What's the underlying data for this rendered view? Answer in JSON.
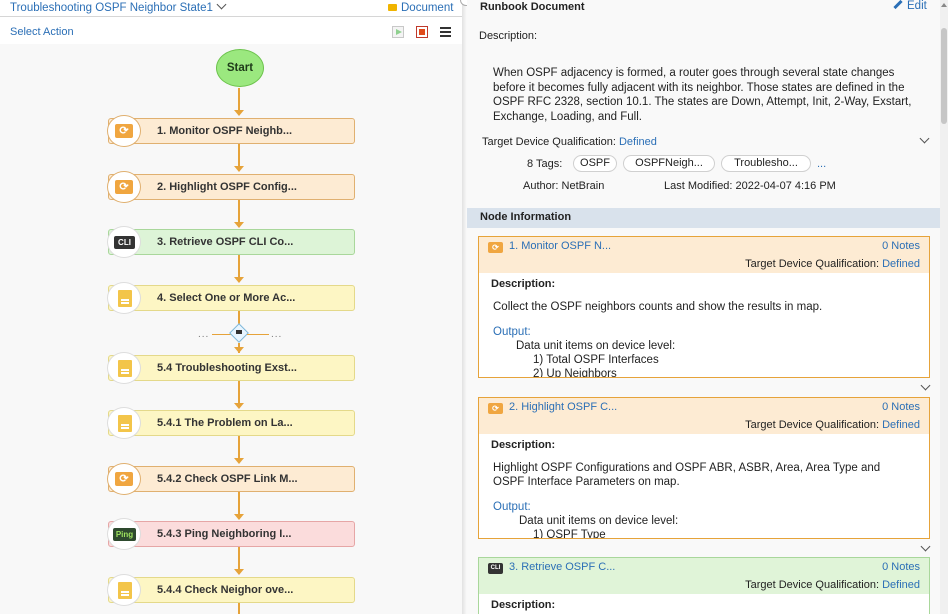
{
  "left": {
    "title": "Troubleshooting OSPF Neighbor State1",
    "document_link": "Document",
    "select_action": "Select Action",
    "start_label": "Start",
    "decision_left": "...",
    "decision_right": "...",
    "nodes": [
      {
        "label": "1. Monitor OSPF Neighb...",
        "color": "orange",
        "icon": "refresh-icon"
      },
      {
        "label": "2. Highlight OSPF Config...",
        "color": "orange",
        "icon": "refresh-icon"
      },
      {
        "label": "3. Retrieve OSPF CLI Co...",
        "color": "green",
        "icon": "cli-icon",
        "icon_text": "CLI"
      },
      {
        "label": "4. Select One or More Ac...",
        "color": "yellow",
        "icon": "document-icon"
      },
      {
        "label": "5.4 Troubleshooting Exst...",
        "color": "yellow",
        "icon": "document-icon"
      },
      {
        "label": "5.4.1 The Problem on La...",
        "color": "yellow",
        "icon": "document-icon"
      },
      {
        "label": "5.4.2 Check OSPF Link M...",
        "color": "orange",
        "icon": "refresh-icon"
      },
      {
        "label": "5.4.3 Ping Neighboring I...",
        "color": "pink",
        "icon": "ping-icon",
        "icon_text": "Ping"
      },
      {
        "label": "5.4.4 Check Neighor ove...",
        "color": "yellow",
        "icon": "document-icon"
      }
    ]
  },
  "runbook": {
    "title": "Runbook Document",
    "edit_label": "Edit",
    "description_label": "Description:",
    "description": "When OSPF adjacency is formed, a router goes through several state changes before it becomes fully adjacent with its neighbor. Those states are defined in the OSPF RFC 2328, section 10.1. The states are Down, Attempt, Init, 2-Way, Exstart, Exchange, Loading, and Full.",
    "tdq_label": "Target Device Qualification:",
    "tdq_value": "Defined",
    "tags_label": "8 Tags:",
    "tags": [
      "OSPF",
      "OSPFNeigh...",
      "Troublesho..."
    ],
    "tags_more": "...",
    "author": "Author: NetBrain",
    "last_modified": "Last Modified: 2022-04-07 4:16 PM"
  },
  "node_info": {
    "title": "Node Information",
    "cards": [
      {
        "title": "1. Monitor OSPF N...",
        "notes": "0 Notes",
        "tdq_label": "Target Device Qualification:",
        "tdq_value": "Defined",
        "description_label": "Description:",
        "description": "Collect the OSPF neighbors counts and show the results in map.",
        "output_label": "Output:",
        "output_lines": [
          "Data unit items on device level:",
          "1) Total OSPF Interfaces",
          "2) Up Neighbors"
        ]
      },
      {
        "title": "2. Highlight OSPF C...",
        "notes": "0 Notes",
        "tdq_label": "Target Device Qualification:",
        "tdq_value": "Defined",
        "description_label": "Description:",
        "description": "Highlight OSPF Configurations and OSPF ABR, ASBR, Area, Area Type and OSPF Interface Parameters on map.",
        "output_label": "Output:",
        "output_lines": [
          "Data unit items on device level:",
          "1) OSPF Type"
        ]
      },
      {
        "title": "3. Retrieve OSPF C...",
        "notes": "0 Notes",
        "tdq_label": "Target Device Qualification:",
        "tdq_value": "Defined",
        "description_label": "Description:",
        "icon_text": "CLI"
      }
    ]
  }
}
